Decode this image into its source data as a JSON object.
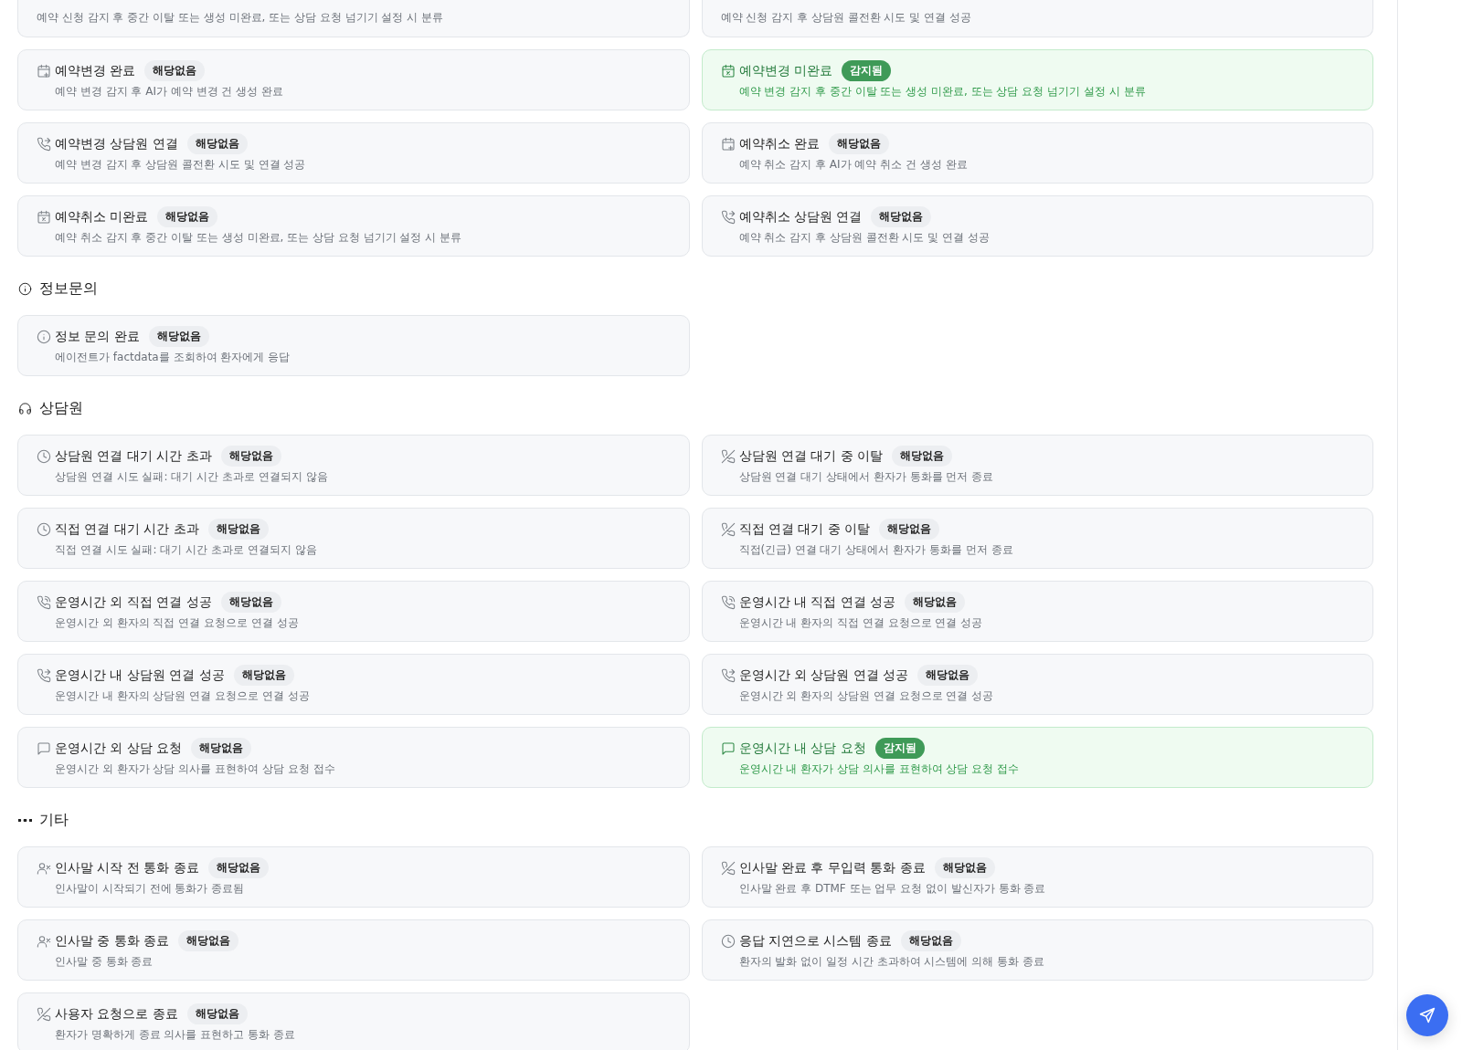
{
  "sections": [
    {
      "cards": [
        {
          "kind": "partial",
          "description": "예약 신청 감지 후 중간 이탈 또는 생성 미완료, 또는 상담 요청 넘기기 설정 시 분류"
        },
        {
          "kind": "partial",
          "description": "예약 신청 감지 후 상담원 콜전환 시도 및 연결 성공"
        },
        {
          "kind": "calendar-plus",
          "title": "예약변경 완료",
          "badge": "해당없음",
          "detected": false,
          "description": "예약 변경 감지 후 AI가 예약 변경 건 생성 완료"
        },
        {
          "kind": "calendar-x",
          "title": "예약변경 미완료",
          "badge": "감지됨",
          "detected": true,
          "description": "예약 변경 감지 후 중간 이탈 또는 생성 미완료, 또는 상담 요청 넘기기 설정 시 분류"
        },
        {
          "kind": "phone-forward",
          "title": "예약변경 상담원 연결",
          "badge": "해당없음",
          "detected": false,
          "description": "예약 변경 감지 후 상담원 콜전환 시도 및 연결 성공"
        },
        {
          "kind": "calendar-plus",
          "title": "예약취소 완료",
          "badge": "해당없음",
          "detected": false,
          "description": "예약 취소 감지 후 AI가 예약 취소 건 생성 완료"
        },
        {
          "kind": "calendar-x",
          "title": "예약취소 미완료",
          "badge": "해당없음",
          "detected": false,
          "description": "예약 취소 감지 후 중간 이탈 또는 생성 미완료, 또는 상담 요청 넘기기 설정 시 분류"
        },
        {
          "kind": "phone-forward",
          "title": "예약취소 상담원 연결",
          "badge": "해당없음",
          "detected": false,
          "description": "예약 취소 감지 후 상담원 콜전환 시도 및 연결 성공"
        }
      ]
    },
    {
      "title": "정보문의",
      "kind": "info",
      "cards": [
        {
          "kind": "info",
          "title": "정보 문의 완료",
          "badge": "해당없음",
          "detected": false,
          "description": "에이전트가 factdata를 조회하여 환자에게 응답"
        }
      ]
    },
    {
      "title": "상담원",
      "kind": "headphones",
      "cards": [
        {
          "kind": "clock",
          "title": "상담원 연결 대기 시간 초과",
          "badge": "해당없음",
          "detected": false,
          "description": "상담원 연결 시도 실패: 대기 시간 초과로 연결되지 않음"
        },
        {
          "kind": "phone-off",
          "title": "상담원 연결 대기 중 이탈",
          "badge": "해당없음",
          "detected": false,
          "description": "상담원 연결 대기 상태에서 환자가 통화를 먼저 종료"
        },
        {
          "kind": "clock",
          "title": "직접 연결 대기 시간 초과",
          "badge": "해당없음",
          "detected": false,
          "description": "직접 연결 시도 실패: 대기 시간 초과로 연결되지 않음"
        },
        {
          "kind": "phone-off",
          "title": "직접 연결 대기 중 이탈",
          "badge": "해당없음",
          "detected": false,
          "description": "직접(긴급) 연결 대기 상태에서 환자가 통화를 먼저 종료"
        },
        {
          "kind": "phone-call",
          "title": "운영시간 외 직접 연결 성공",
          "badge": "해당없음",
          "detected": false,
          "description": "운영시간 외 환자의 직접 연결 요청으로 연결 성공"
        },
        {
          "kind": "phone-call",
          "title": "운영시간 내 직접 연결 성공",
          "badge": "해당없음",
          "detected": false,
          "description": "운영시간 내 환자의 직접 연결 요청으로 연결 성공"
        },
        {
          "kind": "phone-forward",
          "title": "운영시간 내 상담원 연결 성공",
          "badge": "해당없음",
          "detected": false,
          "description": "운영시간 내 환자의 상담원 연결 요청으로 연결 성공"
        },
        {
          "kind": "phone-forward",
          "title": "운영시간 외 상담원 연결 성공",
          "badge": "해당없음",
          "detected": false,
          "description": "운영시간 외 환자의 상담원 연결 요청으로 연결 성공"
        },
        {
          "kind": "message",
          "title": "운영시간 외 상담 요청",
          "badge": "해당없음",
          "detected": false,
          "description": "운영시간 외 환자가 상담 의사를 표현하여 상담 요청 접수"
        },
        {
          "kind": "message",
          "title": "운영시간 내 상담 요청",
          "badge": "감지됨",
          "detected": true,
          "description": "운영시간 내 환자가 상담 의사를 표현하여 상담 요청 접수"
        }
      ]
    },
    {
      "title": "기타",
      "kind": "dots",
      "cards": [
        {
          "kind": "user-x",
          "title": "인사말 시작 전 통화 종료",
          "badge": "해당없음",
          "detected": false,
          "description": "인사말이 시작되기 전에 통화가 종료됨"
        },
        {
          "kind": "phone-off",
          "title": "인사말 완료 후 무입력 통화 종료",
          "badge": "해당없음",
          "detected": false,
          "description": "인사말 완료 후 DTMF 또는 업무 요청 없이 발신자가 통화 종료"
        },
        {
          "kind": "user-x",
          "title": "인사말 중 통화 종료",
          "badge": "해당없음",
          "detected": false,
          "description": "인사말 중 통화 종료"
        },
        {
          "kind": "clock",
          "title": "응답 지연으로 시스템 종료",
          "badge": "해당없음",
          "detected": false,
          "description": "환자의 발화 없이 일정 시간 초과하여 시스템에 의해 통화 종료"
        },
        {
          "kind": "phone-off",
          "title": "사용자 요청으로 종료",
          "badge": "해당없음",
          "detected": false,
          "description": "환자가 명확하게 종료 의사를 표현하고 통화 종료"
        }
      ]
    }
  ]
}
